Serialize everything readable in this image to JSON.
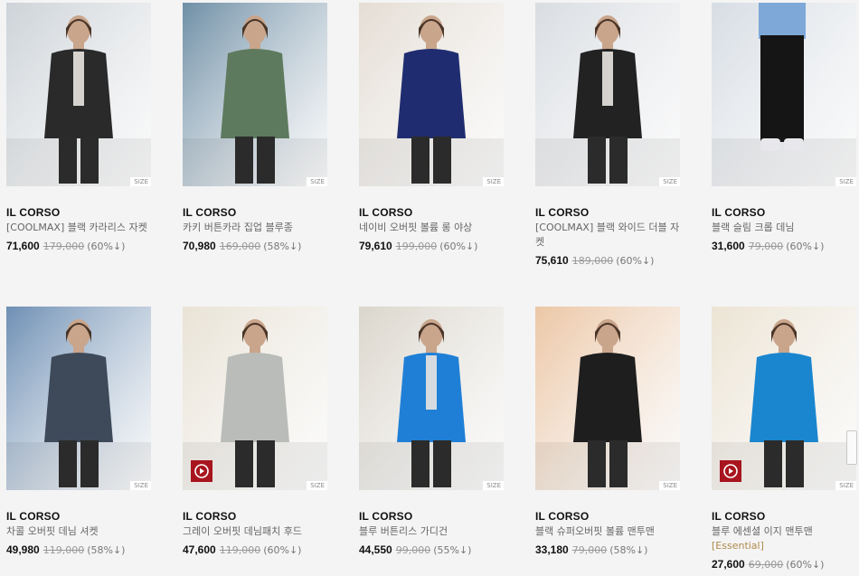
{
  "size_label": "SIZE",
  "products": [
    {
      "brand": "IL CORSO",
      "name": "[COOLMAX] 블랙 카라리스 자켓",
      "price": "71,600",
      "original": "179,000",
      "discount": "(60%↓)",
      "tag": "",
      "video": false,
      "bg": "#cdd3d8",
      "accent": "#2a2a2a"
    },
    {
      "brand": "IL CORSO",
      "name": "카키 버튼카라 집업 블루종",
      "price": "70,980",
      "original": "169,000",
      "discount": "(58%↓)",
      "tag": "",
      "video": false,
      "bg": "#6f8fa6",
      "accent": "#5d7a5e"
    },
    {
      "brand": "IL CORSO",
      "name": "네이비 오버핏 볼륨 롱 야상",
      "price": "79,610",
      "original": "199,000",
      "discount": "(60%↓)",
      "tag": "",
      "video": false,
      "bg": "#e4ddd4",
      "accent": "#1f2d70"
    },
    {
      "brand": "IL CORSO",
      "name": "[COOLMAX] 블랙 와이드 더블 자켓",
      "price": "75,610",
      "original": "189,000",
      "discount": "(60%↓)",
      "tag": "",
      "video": false,
      "bg": "#d9dde2",
      "accent": "#222222"
    },
    {
      "brand": "IL CORSO",
      "name": "블랙 슬림 크롭 데님",
      "price": "31,600",
      "original": "79,000",
      "discount": "(60%↓)",
      "tag": "",
      "video": false,
      "bg": "#d7dde4",
      "accent": "#1c1c1c"
    },
    {
      "brand": "IL CORSO",
      "name": "차콜 오버핏 데님 셔켓",
      "price": "49,980",
      "original": "119,000",
      "discount": "(58%↓)",
      "tag": "",
      "video": false,
      "bg": "#6e8fb4",
      "accent": "#3e4a5a"
    },
    {
      "brand": "IL CORSO",
      "name": "그레이 오버핏 데님패치 후드",
      "price": "47,600",
      "original": "119,000",
      "discount": "(60%↓)",
      "tag": "",
      "video": true,
      "bg": "#e9e3d6",
      "accent": "#b9bcb8"
    },
    {
      "brand": "IL CORSO",
      "name": "블루 버튼리스 가디건",
      "price": "44,550",
      "original": "99,000",
      "discount": "(55%↓)",
      "tag": "",
      "video": false,
      "bg": "#dbd6cc",
      "accent": "#1f7fd6"
    },
    {
      "brand": "IL CORSO",
      "name": "블랙 슈퍼오버핏 볼륨 맨투맨",
      "price": "33,180",
      "original": "79,000",
      "discount": "(58%↓)",
      "tag": "",
      "video": false,
      "bg": "#ecc7a6",
      "accent": "#1e1e1e"
    },
    {
      "brand": "IL CORSO",
      "name": "블루 에센셜 이지 맨투맨",
      "price": "27,600",
      "original": "69,000",
      "discount": "(60%↓)",
      "tag": "[Essential]",
      "video": true,
      "bg": "#ece4d4",
      "accent": "#1a86cf"
    }
  ]
}
